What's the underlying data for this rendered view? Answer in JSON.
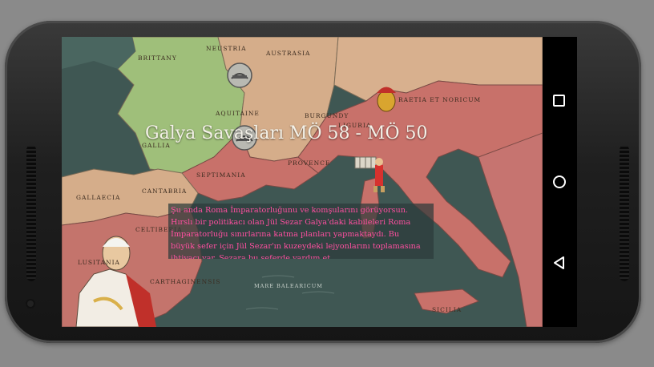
{
  "game": {
    "title": "Galya Savaşları MÖ 58 - MÖ 50",
    "dialog_lines": [
      "Şu anda Roma İmparatorluğunu ve komşularını görüyorsun.",
      "Hırslı bir politikacı olan Jül Sezar Galya'daki kabileleri Roma",
      "İmparatorluğu sınırlarına katma planları yapmaktaydı. Bu",
      "büyük sefer için Jül Sezar'ın kuzeydeki lejyonlarını toplamasına",
      "ihtiyacı var. Sezara bu seferde yardım et."
    ],
    "regions": {
      "brittany": "BRITTANY",
      "neustria": "NEUSTRIA",
      "austrasia": "AUSTRASIA",
      "aquitaine": "AQUITAINE",
      "burgundy": "BURGUNDY",
      "gallia": "GALLIA",
      "provence": "PROVENCE",
      "septimania": "SEPTIMANIA",
      "liguria": "LIGURIA",
      "raetia": "RAETIA ET NORICUM",
      "gallaecia": "GALLAECIA",
      "cantabria": "CANTABRIA",
      "lusitania": "LUSITANIA",
      "celtiberia": "CELTIBERIA",
      "carthaginensis": "CARTHAGINENSIS",
      "sicilia": "SICILIA",
      "mare_balearicum": "MARE BALEARICUM"
    }
  },
  "colors": {
    "sea": "#3e5552",
    "roman_red": "#c8716a",
    "gaul_green": "#9fbf7a",
    "neutral_tan": "#d5ad8a",
    "dialog_text": "#ff4fa0"
  },
  "nav": {
    "recents": "square-icon",
    "home": "circle-icon",
    "back": "triangle-back-icon"
  }
}
